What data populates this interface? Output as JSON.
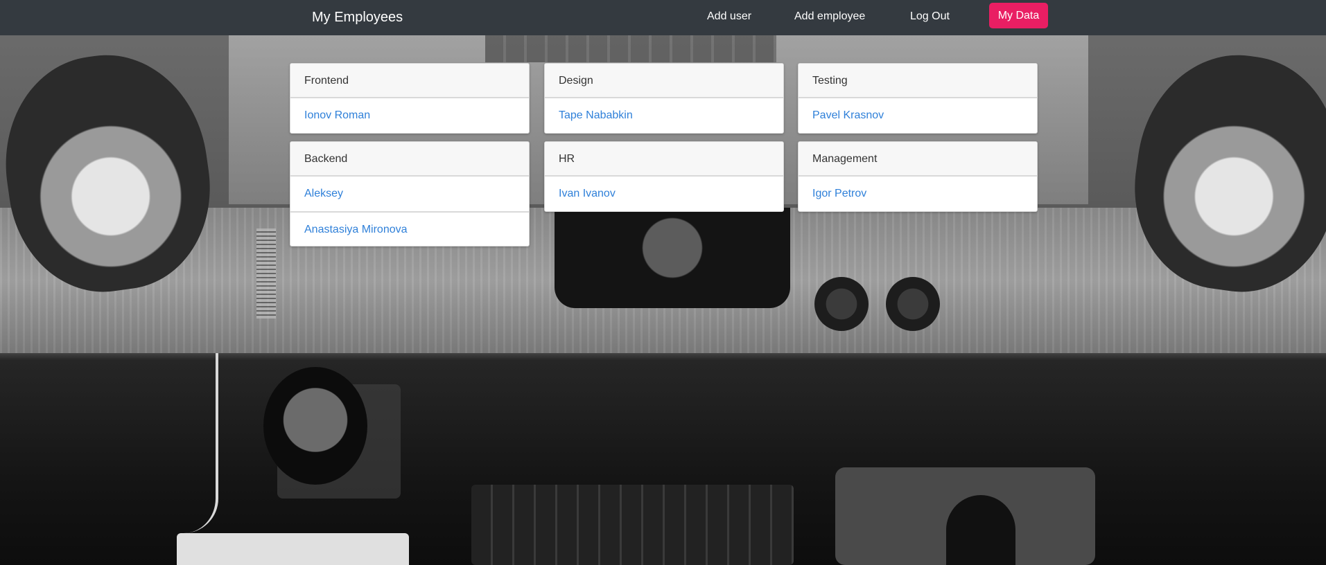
{
  "navbar": {
    "brand": "My Employees",
    "links": {
      "add_user": "Add user",
      "add_employee": "Add employee",
      "logout": "Log Out"
    },
    "my_data_button": "My Data",
    "colors": {
      "background": "#343a40",
      "button": "#e91e63"
    }
  },
  "departments": [
    {
      "name": "Frontend",
      "employees": [
        "Ionov Roman"
      ]
    },
    {
      "name": "Design",
      "employees": [
        "Tape Nababkin"
      ]
    },
    {
      "name": "Testing",
      "employees": [
        "Pavel Krasnov"
      ]
    },
    {
      "name": "Backend",
      "employees": [
        "Aleksey",
        "Anastasiya Mironova"
      ]
    },
    {
      "name": "HR",
      "employees": [
        "Ivan Ivanov"
      ]
    },
    {
      "name": "Management",
      "employees": [
        "Igor Petrov"
      ]
    }
  ],
  "colors": {
    "employee_link": "#2f80d9",
    "card_header_bg": "#f7f7f7"
  }
}
